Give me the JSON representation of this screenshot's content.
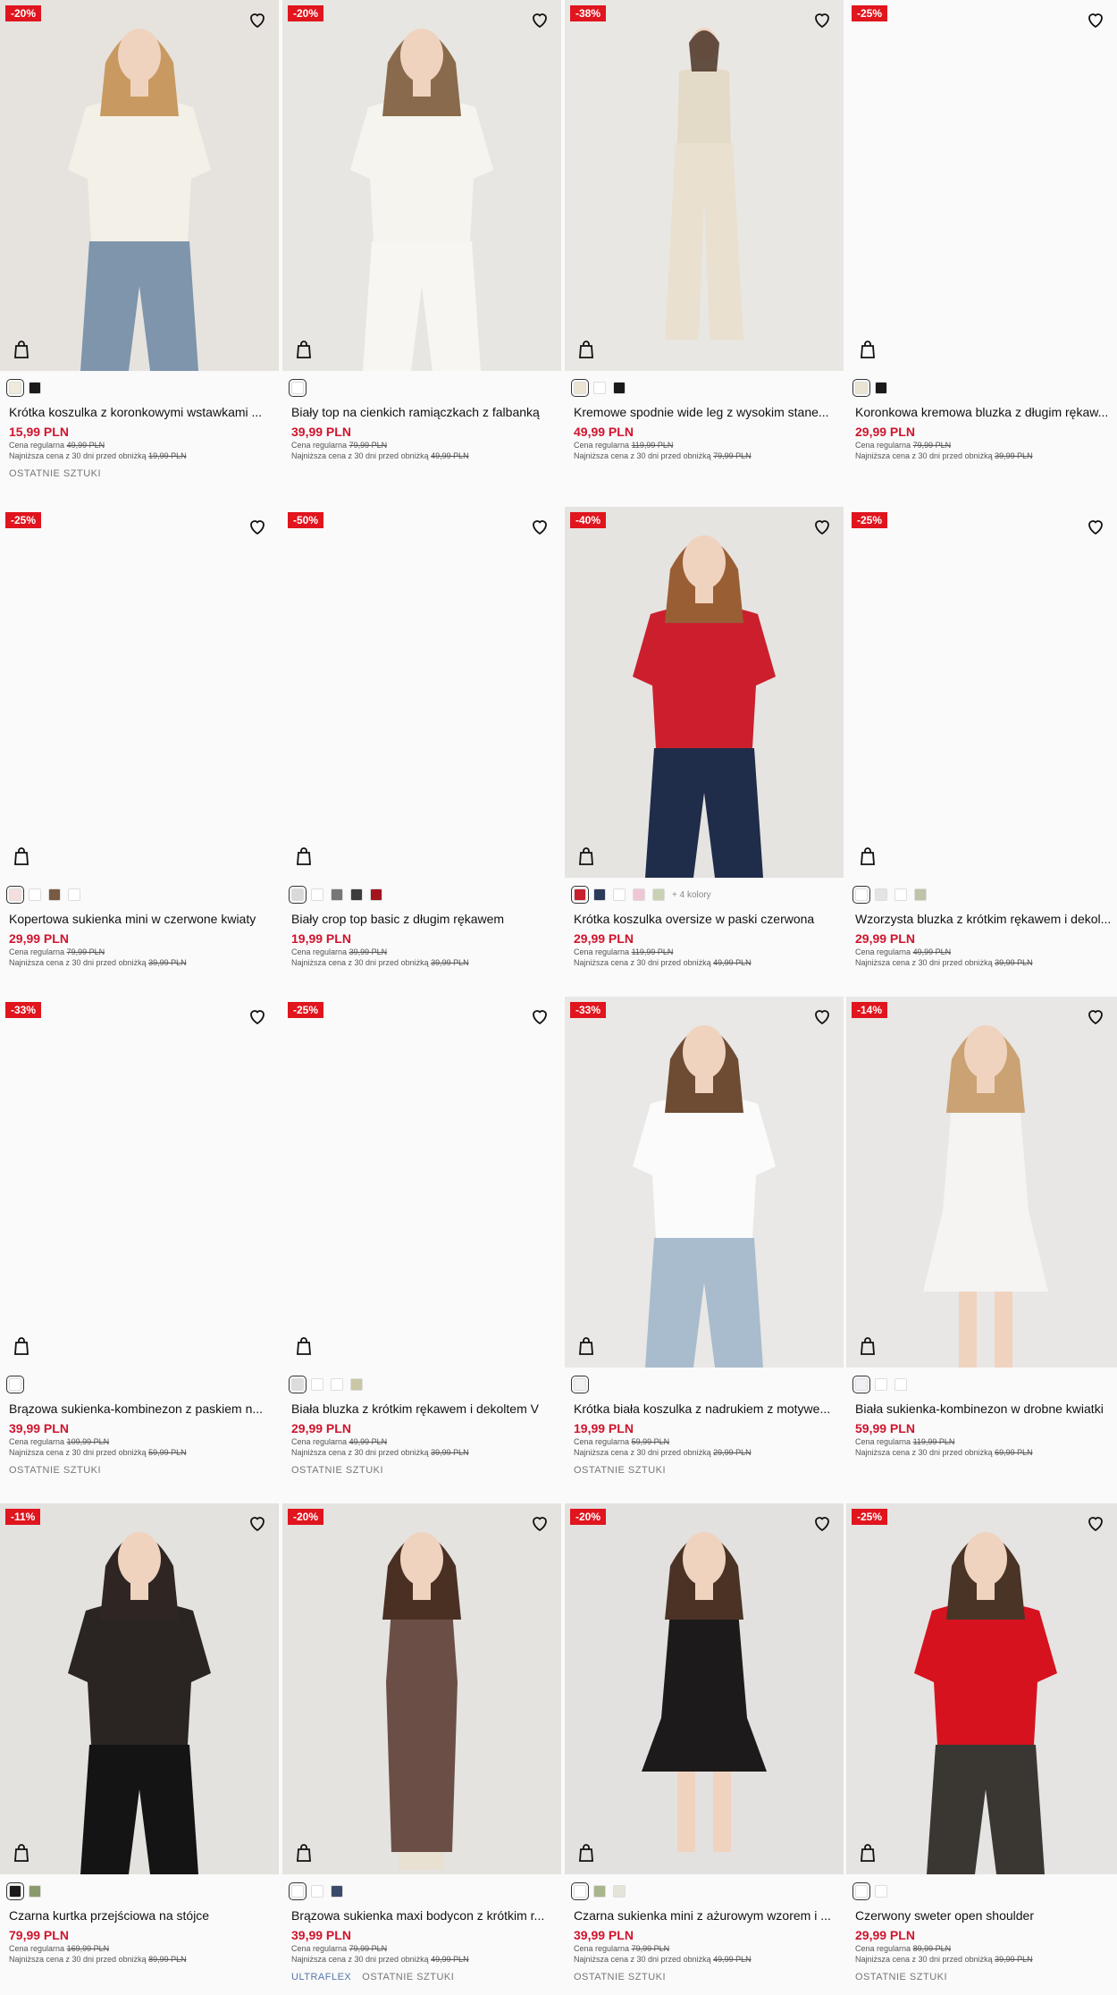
{
  "ui": {
    "regular_price_label": "Cena regularna",
    "lowest_price_label": "Najniższa cena z 30 dni przed obniżką"
  },
  "products": [
    {
      "badge": "-20%",
      "name": "Krótka koszulka z koronkowymi wstawkami ...",
      "price": "15,99 PLN",
      "regular": "49,99 PLN",
      "lowest": "19,99 PLN",
      "swatches": [
        "#efeadb",
        "#1a1a1a"
      ],
      "tags": [
        "OSTATNIE SZTUKI"
      ],
      "photo": {
        "bg": "#e6e3df",
        "figure": "top-jeans",
        "top": "#f3f0e8",
        "bottom": "#7e95ab",
        "hair": "#c89a62"
      }
    },
    {
      "badge": "-20%",
      "name": "Biały top na cienkich ramiączkach z falbanką",
      "price": "39,99 PLN",
      "regular": "79,99 PLN",
      "lowest": "49,99 PLN",
      "swatches": [
        "#ffffff"
      ],
      "tags": [],
      "photo": {
        "bg": "#e7e6e2",
        "figure": "cami-pants",
        "top": "#f6f4ef",
        "bottom": "#f7f6f3",
        "hair": "#8a6a4c"
      }
    },
    {
      "badge": "-38%",
      "name": "Kremowe spodnie wide leg z wysokim stane...",
      "price": "49,99 PLN",
      "regular": "119,99 PLN",
      "lowest": "79,99 PLN",
      "swatches": [
        "#ece4d2",
        "#ffffff",
        "#1a1a1a"
      ],
      "tags": [],
      "photo": {
        "bg": "#e9e7e3",
        "figure": "vest-pants",
        "top": "#e4dac8",
        "bottom": "#e9e0cf",
        "hair": "#4a3426"
      }
    },
    {
      "badge": "-25%",
      "name": "Koronkowa kremowa bluzka z długim rękaw...",
      "price": "29,99 PLN",
      "regular": "79,99 PLN",
      "lowest": "39,99 PLN",
      "swatches": [
        "#ece4d2",
        "#1a1a1a"
      ],
      "tags": [],
      "photo": {
        "bg": "#fafafa",
        "figure": "none"
      }
    },
    {
      "badge": "-25%",
      "name": "Kopertowa sukienka mini w czerwone kwiaty",
      "price": "29,99 PLN",
      "regular": "79,99 PLN",
      "lowest": "39,99 PLN",
      "swatches": [
        "#f4dede",
        "#ffffff",
        "#7a5a44",
        "#ffffff"
      ],
      "tags": [],
      "photo": {
        "bg": "#fafafa",
        "figure": "none"
      }
    },
    {
      "badge": "-50%",
      "name": "Biały crop top basic z długim rękawem",
      "price": "19,99 PLN",
      "regular": "39,99 PLN",
      "lowest": "39,99 PLN",
      "swatches": [
        "#d9d9d9",
        "#ffffff",
        "#777777",
        "#3d3d3d",
        "#a3141d"
      ],
      "tags": [],
      "photo": {
        "bg": "#fafafa",
        "figure": "none"
      }
    },
    {
      "badge": "-40%",
      "name": "Krótka koszulka oversize w paski czerwona",
      "price": "29,99 PLN",
      "regular": "119,99 PLN",
      "lowest": "49,99 PLN",
      "swatches": [
        "#c8202c",
        "#2c3a5a",
        "#ffffff",
        "#f0c6d4",
        "#c9d1b5"
      ],
      "more": "+ 4 kolory",
      "tags": [],
      "photo": {
        "bg": "#e5e4e1",
        "figure": "stripe-tee",
        "top": "#cc1f2e",
        "bottom": "#1f2c4a",
        "hair": "#9a5e35"
      }
    },
    {
      "badge": "-25%",
      "name": "Wzorzysta bluzka z krótkim rękawem i dekol...",
      "price": "29,99 PLN",
      "regular": "49,99 PLN",
      "lowest": "39,99 PLN",
      "swatches": [
        "#ffffff",
        "#e4e4e4",
        "#ffffff",
        "#bfc4a8"
      ],
      "tags": [],
      "photo": {
        "bg": "#fafafa",
        "figure": "none"
      }
    },
    {
      "badge": "-33%",
      "name": "Brązowa sukienka-kombinezon z paskiem n...",
      "price": "39,99 PLN",
      "regular": "109,99 PLN",
      "lowest": "59,99 PLN",
      "swatches": [
        "#ffffff"
      ],
      "tags": [
        "OSTATNIE SZTUKI"
      ],
      "photo": {
        "bg": "#fafafa",
        "figure": "none"
      }
    },
    {
      "badge": "-25%",
      "name": "Biała bluzka z krótkim rękawem i dekoltem V",
      "price": "29,99 PLN",
      "regular": "49,99 PLN",
      "lowest": "39,99 PLN",
      "swatches": [
        "#dcdcdc",
        "#ffffff",
        "#ffffff",
        "#c9c7a6"
      ],
      "tags": [
        "OSTATNIE SZTUKI"
      ],
      "photo": {
        "bg": "#fafafa",
        "figure": "none"
      }
    },
    {
      "badge": "-33%",
      "name": "Krótka biała koszulka z nadrukiem z motywe...",
      "price": "19,99 PLN",
      "regular": "59,99 PLN",
      "lowest": "29,99 PLN",
      "swatches": [
        "#f0f0f0"
      ],
      "tags": [
        "OSTATNIE SZTUKI"
      ],
      "photo": {
        "bg": "#e9e8e6",
        "figure": "print-tee",
        "top": "#fbfbfb",
        "bottom": "#a9bccd",
        "hair": "#6e4c34"
      }
    },
    {
      "badge": "-14%",
      "name": "Biała sukienka-kombinezon w drobne kwiatki",
      "price": "59,99 PLN",
      "regular": "119,99 PLN",
      "lowest": "69,99 PLN",
      "swatches": [
        "#eef0f4",
        "#ffffff",
        "#ffffff"
      ],
      "tags": [],
      "photo": {
        "bg": "#e8e7e5",
        "figure": "dress",
        "top": "#f5f4f2",
        "bottom": "#f5f4f2",
        "hair": "#caa273"
      }
    },
    {
      "badge": "-11%",
      "name": "Czarna kurtka przejściowa na stójce",
      "price": "79,99 PLN",
      "regular": "169,99 PLN",
      "lowest": "89,99 PLN",
      "swatches": [
        "#1a1a1a",
        "#8a9a6a"
      ],
      "tags": [],
      "photo": {
        "bg": "#e3e2df",
        "figure": "jacket",
        "top": "#2a2523",
        "bottom": "#141414",
        "hair": "#2f2623"
      }
    },
    {
      "badge": "-20%",
      "name": "Brązowa sukienka maxi bodycon z krótkim r...",
      "price": "39,99 PLN",
      "regular": "79,99 PLN",
      "lowest": "49,99 PLN",
      "swatches": [
        "#ffffff",
        "#ffffff",
        "#3c4a6a"
      ],
      "tags": [
        "ULTRAFLEX",
        "OSTATNIE SZTUKI"
      ],
      "photo": {
        "bg": "#e4e3e0",
        "figure": "maxi",
        "top": "#6b4f47",
        "bottom": "#6b4f47",
        "hair": "#4a3023"
      }
    },
    {
      "badge": "-20%",
      "name": "Czarna sukienka mini z ażurowym wzorem i ...",
      "price": "39,99 PLN",
      "regular": "79,99 PLN",
      "lowest": "49,99 PLN",
      "swatches": [
        "#ffffff",
        "#a9b58a",
        "#e4e4d8"
      ],
      "tags": [
        "OSTATNIE SZTUKI"
      ],
      "photo": {
        "bg": "#e2e1df",
        "figure": "mini-dress",
        "top": "#1c1a1a",
        "bottom": "#1c1a1a",
        "hair": "#4a3325"
      }
    },
    {
      "badge": "-25%",
      "name": "Czerwony sweter open shoulder",
      "price": "29,99 PLN",
      "regular": "89,99 PLN",
      "lowest": "39,99 PLN",
      "swatches": [
        "#ffffff",
        "#ffffff"
      ],
      "tags": [
        "OSTATNIE SZTUKI"
      ],
      "photo": {
        "bg": "#e5e4e2",
        "figure": "sweater",
        "top": "#d6121f",
        "bottom": "#3a3733",
        "hair": "#4a3426"
      }
    }
  ]
}
